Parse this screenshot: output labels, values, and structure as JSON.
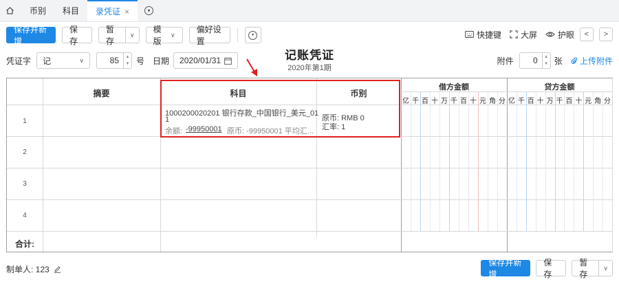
{
  "tabs": {
    "items": [
      {
        "label": "币别"
      },
      {
        "label": "科目"
      },
      {
        "label": "录凭证",
        "close": "×"
      }
    ]
  },
  "toolbar": {
    "save_new": "保存并新增",
    "save": "保存",
    "draft": "暂存",
    "template": "模版",
    "prefs": "偏好设置"
  },
  "toolright": {
    "shortcut": "快捷键",
    "fullscreen": "大屏",
    "eye_protect": "护眼",
    "prev": "<",
    "next": ">"
  },
  "voucher": {
    "type_label": "凭证字",
    "type_value": "记",
    "number_value": "85",
    "number_suffix": "号",
    "date_label": "日期",
    "date_value": "2020/01/31",
    "title": "记账凭证",
    "period": "2020年第1期",
    "attach_label": "附件",
    "attach_value": "0",
    "attach_unit": "张",
    "upload_label": "上传附件"
  },
  "grid": {
    "headers": {
      "summary": "摘要",
      "account": "科目",
      "currency": "币别",
      "debit": "借方金额",
      "credit": "贷方金额"
    },
    "digits": [
      "亿",
      "千",
      "百",
      "十",
      "万",
      "千",
      "百",
      "十",
      "元",
      "角",
      "分"
    ],
    "rows": [
      "1",
      "2",
      "3",
      "4"
    ],
    "row1": {
      "account_line1": "1000200020201    银行存款_中国银行_美元_01",
      "account_line1b": "1",
      "balance_label": "余额:",
      "balance_value": "-99950001",
      "original_text": "原币: -99950001 平均汇...",
      "currency_line1": "原币:  RMB 0",
      "currency_line2": "汇率:  1"
    },
    "total_label": "合计:"
  },
  "footer": {
    "maker_label": "制单人: 123",
    "save_new": "保存并新增",
    "save": "保存",
    "draft": "暂存"
  }
}
